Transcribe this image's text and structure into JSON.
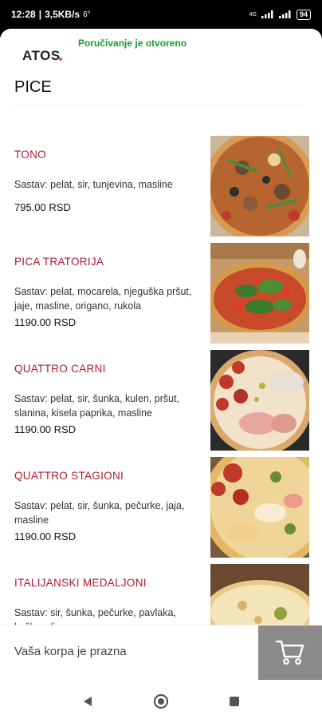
{
  "status_bar": {
    "time": "12:28",
    "network_speed": "3,5KB/s",
    "temperature": "6°",
    "signal": "4G",
    "battery": "94"
  },
  "header": {
    "logo_text": "ATOS",
    "order_status": "Poručivanje je otvoreno",
    "section_title": "PICE"
  },
  "menu": {
    "items": [
      {
        "name": "TONO",
        "description": "Sastav: pelat, sir, tunjevina, masline",
        "price": "795.00 RSD",
        "image_icon": "tuna-pizza-photo"
      },
      {
        "name": "PICA TRATORIJA",
        "description": "Sastav: pelat, mocarela, njeguška pršut, jaje, masline, origano, rukola",
        "price": "1190.00 RSD",
        "image_icon": "tratorija-pizza-photo"
      },
      {
        "name": "QUATTRO CARNI",
        "description": "Sastav: pelat, sir, šunka, kulen, pršut, slanina, kisela paprika, masline",
        "price": "1190.00 RSD",
        "image_icon": "quattro-carni-pizza-photo"
      },
      {
        "name": "QUATTRO STAGIONI",
        "description": "Sastav: pelat, sir, šunka, pečurke, jaja, masline",
        "price": "1190.00 RSD",
        "image_icon": "quattro-stagioni-pizza-photo"
      },
      {
        "name": "ITALIJANSKI MEDALJONI",
        "description": "Sastav: sir, šunka, pečurke, pavlaka, kačkavalj",
        "price": "",
        "image_icon": "medaljoni-pizza-photo"
      }
    ]
  },
  "cart": {
    "empty_text": "Vaša korpa je prazna",
    "icon": "cart-icon"
  },
  "colors": {
    "item_name": "#b0192e",
    "open_status": "#1a9c2a",
    "cart_button": "#8a8a8a"
  }
}
